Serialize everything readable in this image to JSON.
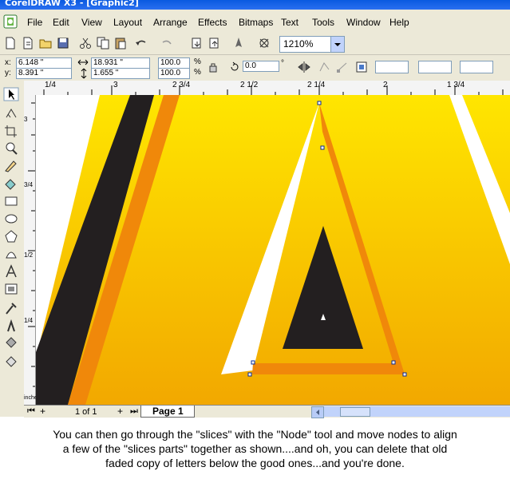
{
  "window": {
    "title": "CorelDRAW X3 - [Graphic2]"
  },
  "menu": [
    "File",
    "Edit",
    "View",
    "Layout",
    "Arrange",
    "Effects",
    "Bitmaps",
    "Text",
    "Tools",
    "Window",
    "Help"
  ],
  "toolbar": {
    "zoom": "1210%"
  },
  "property_bar": {
    "x_label": "x:",
    "x_value": "6.148 \"",
    "y_label": "y:",
    "y_value": "8.391 \"",
    "width_value": "18.931 \"",
    "height_value": "1.655 \"",
    "scale_x": "100.0",
    "scale_y": "100.0",
    "percent": "%",
    "rotation": "0.0",
    "degree": "°"
  },
  "ruler_top": [
    "1/4",
    "3",
    "2 3/4",
    "2 1/2",
    "2 1/4",
    "2",
    "1 3/4"
  ],
  "ruler_left": [
    "3",
    "3/4",
    "1/2",
    "1/4"
  ],
  "ruler_unit": "inches",
  "status": {
    "page_count": "1 of 1",
    "page_tab": "Page 1"
  },
  "caption": {
    "line1": "You can then go through the \"slices\" with the \"Node\" tool and move nodes to align",
    "line2": "a few of the \"slices parts\" together as shown....and oh, you can delete that old",
    "line3": "faded copy of letters below the good ones...and you're done."
  },
  "colors": {
    "gradient_top": "#ffe600",
    "gradient_bottom": "#f2a800",
    "orange": "#f0880a",
    "dark": "#231f20",
    "xp_face": "#ece9d8"
  }
}
